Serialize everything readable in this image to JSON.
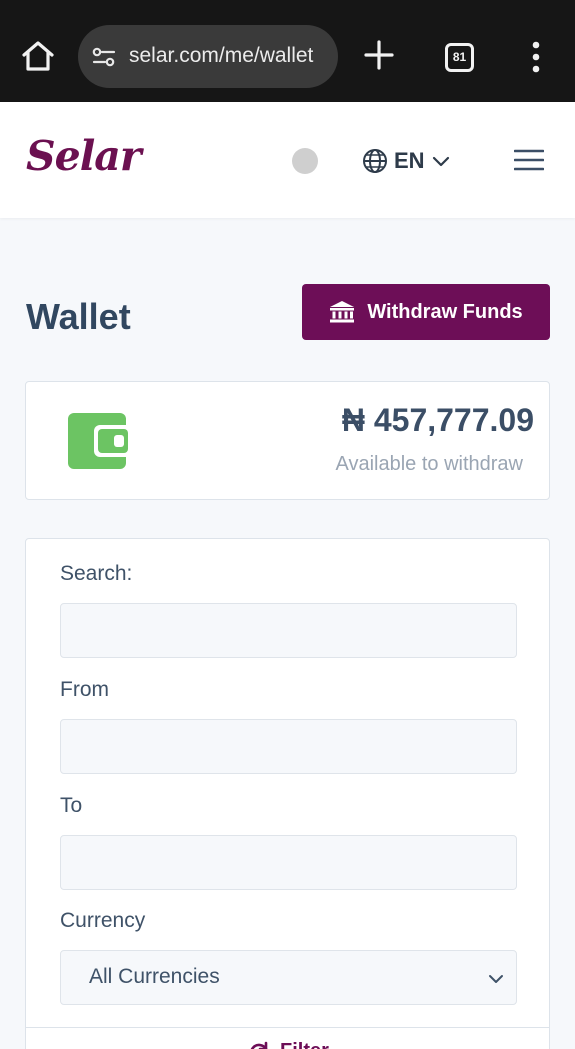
{
  "browser": {
    "url": "selar.com/me/wallet",
    "tab_count": "81",
    "icons": {
      "home": "home-icon",
      "site_settings": "tune-icon",
      "new_tab": "plus-icon",
      "menu": "more-vert-icon"
    }
  },
  "header": {
    "logo_text": "Selar",
    "language": "EN",
    "brand_color": "#6d0e57"
  },
  "page": {
    "title": "Wallet",
    "withdraw_label": "Withdraw Funds"
  },
  "balance": {
    "amount": "₦ 457,777.09",
    "caption": "Available to withdraw",
    "icon_color": "#6cc463"
  },
  "filters": {
    "search_label": "Search:",
    "search_value": "",
    "from_label": "From",
    "from_value": "",
    "to_label": "To",
    "to_value": "",
    "currency_label": "Currency",
    "currency_selected": "All Currencies",
    "filter_button": "Filter"
  }
}
